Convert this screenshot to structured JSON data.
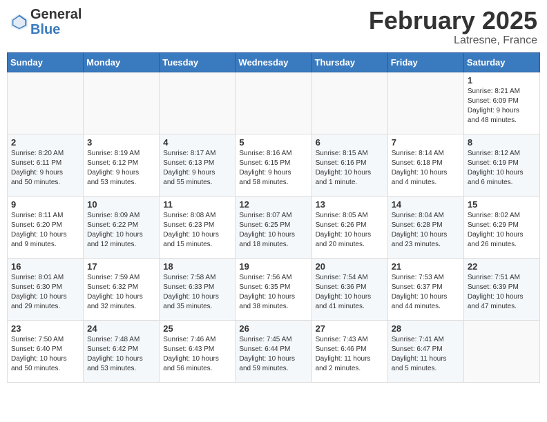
{
  "header": {
    "logo_general": "General",
    "logo_blue": "Blue",
    "month_title": "February 2025",
    "location": "Latresne, France"
  },
  "weekdays": [
    "Sunday",
    "Monday",
    "Tuesday",
    "Wednesday",
    "Thursday",
    "Friday",
    "Saturday"
  ],
  "weeks": [
    {
      "days": [
        {
          "number": "",
          "info": ""
        },
        {
          "number": "",
          "info": ""
        },
        {
          "number": "",
          "info": ""
        },
        {
          "number": "",
          "info": ""
        },
        {
          "number": "",
          "info": ""
        },
        {
          "number": "",
          "info": ""
        },
        {
          "number": "1",
          "info": "Sunrise: 8:21 AM\nSunset: 6:09 PM\nDaylight: 9 hours\nand 48 minutes."
        }
      ]
    },
    {
      "days": [
        {
          "number": "2",
          "info": "Sunrise: 8:20 AM\nSunset: 6:11 PM\nDaylight: 9 hours\nand 50 minutes."
        },
        {
          "number": "3",
          "info": "Sunrise: 8:19 AM\nSunset: 6:12 PM\nDaylight: 9 hours\nand 53 minutes."
        },
        {
          "number": "4",
          "info": "Sunrise: 8:17 AM\nSunset: 6:13 PM\nDaylight: 9 hours\nand 55 minutes."
        },
        {
          "number": "5",
          "info": "Sunrise: 8:16 AM\nSunset: 6:15 PM\nDaylight: 9 hours\nand 58 minutes."
        },
        {
          "number": "6",
          "info": "Sunrise: 8:15 AM\nSunset: 6:16 PM\nDaylight: 10 hours\nand 1 minute."
        },
        {
          "number": "7",
          "info": "Sunrise: 8:14 AM\nSunset: 6:18 PM\nDaylight: 10 hours\nand 4 minutes."
        },
        {
          "number": "8",
          "info": "Sunrise: 8:12 AM\nSunset: 6:19 PM\nDaylight: 10 hours\nand 6 minutes."
        }
      ]
    },
    {
      "days": [
        {
          "number": "9",
          "info": "Sunrise: 8:11 AM\nSunset: 6:20 PM\nDaylight: 10 hours\nand 9 minutes."
        },
        {
          "number": "10",
          "info": "Sunrise: 8:09 AM\nSunset: 6:22 PM\nDaylight: 10 hours\nand 12 minutes."
        },
        {
          "number": "11",
          "info": "Sunrise: 8:08 AM\nSunset: 6:23 PM\nDaylight: 10 hours\nand 15 minutes."
        },
        {
          "number": "12",
          "info": "Sunrise: 8:07 AM\nSunset: 6:25 PM\nDaylight: 10 hours\nand 18 minutes."
        },
        {
          "number": "13",
          "info": "Sunrise: 8:05 AM\nSunset: 6:26 PM\nDaylight: 10 hours\nand 20 minutes."
        },
        {
          "number": "14",
          "info": "Sunrise: 8:04 AM\nSunset: 6:28 PM\nDaylight: 10 hours\nand 23 minutes."
        },
        {
          "number": "15",
          "info": "Sunrise: 8:02 AM\nSunset: 6:29 PM\nDaylight: 10 hours\nand 26 minutes."
        }
      ]
    },
    {
      "days": [
        {
          "number": "16",
          "info": "Sunrise: 8:01 AM\nSunset: 6:30 PM\nDaylight: 10 hours\nand 29 minutes."
        },
        {
          "number": "17",
          "info": "Sunrise: 7:59 AM\nSunset: 6:32 PM\nDaylight: 10 hours\nand 32 minutes."
        },
        {
          "number": "18",
          "info": "Sunrise: 7:58 AM\nSunset: 6:33 PM\nDaylight: 10 hours\nand 35 minutes."
        },
        {
          "number": "19",
          "info": "Sunrise: 7:56 AM\nSunset: 6:35 PM\nDaylight: 10 hours\nand 38 minutes."
        },
        {
          "number": "20",
          "info": "Sunrise: 7:54 AM\nSunset: 6:36 PM\nDaylight: 10 hours\nand 41 minutes."
        },
        {
          "number": "21",
          "info": "Sunrise: 7:53 AM\nSunset: 6:37 PM\nDaylight: 10 hours\nand 44 minutes."
        },
        {
          "number": "22",
          "info": "Sunrise: 7:51 AM\nSunset: 6:39 PM\nDaylight: 10 hours\nand 47 minutes."
        }
      ]
    },
    {
      "days": [
        {
          "number": "23",
          "info": "Sunrise: 7:50 AM\nSunset: 6:40 PM\nDaylight: 10 hours\nand 50 minutes."
        },
        {
          "number": "24",
          "info": "Sunrise: 7:48 AM\nSunset: 6:42 PM\nDaylight: 10 hours\nand 53 minutes."
        },
        {
          "number": "25",
          "info": "Sunrise: 7:46 AM\nSunset: 6:43 PM\nDaylight: 10 hours\nand 56 minutes."
        },
        {
          "number": "26",
          "info": "Sunrise: 7:45 AM\nSunset: 6:44 PM\nDaylight: 10 hours\nand 59 minutes."
        },
        {
          "number": "27",
          "info": "Sunrise: 7:43 AM\nSunset: 6:46 PM\nDaylight: 11 hours\nand 2 minutes."
        },
        {
          "number": "28",
          "info": "Sunrise: 7:41 AM\nSunset: 6:47 PM\nDaylight: 11 hours\nand 5 minutes."
        },
        {
          "number": "",
          "info": ""
        }
      ]
    }
  ]
}
